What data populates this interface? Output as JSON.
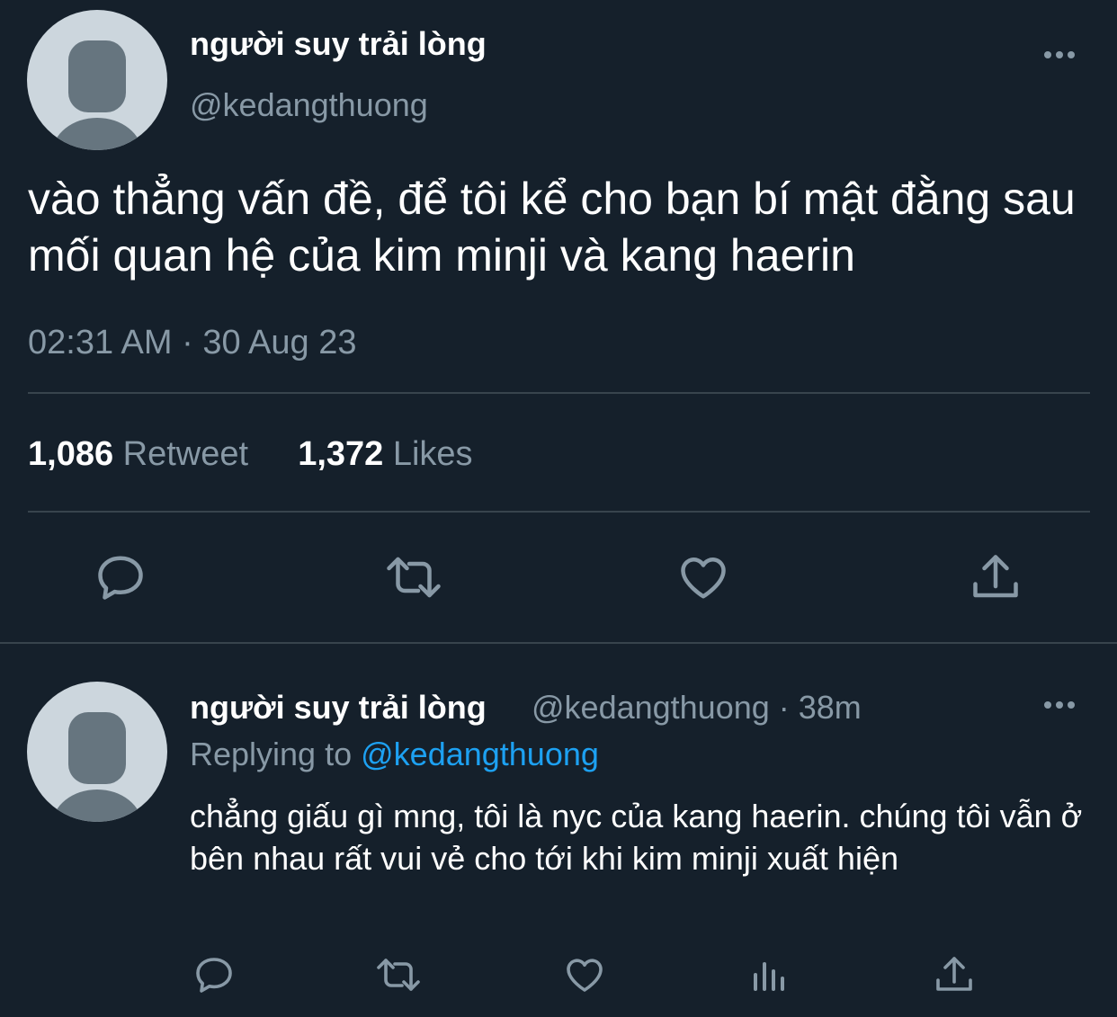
{
  "main_tweet": {
    "author_name": "người suy trải lòng",
    "author_handle": "@kedangthuong",
    "text": "vào thẳng vấn đề, để tôi kể cho bạn bí mật đằng sau mối quan hệ của kim minji và kang haerin",
    "timestamp": "02:31 AM · 30 Aug 23",
    "retweet_count": "1,086",
    "retweet_label": "Retweet",
    "like_count": "1,372",
    "like_label": "Likes",
    "actions": [
      "reply-icon",
      "retweet-icon",
      "heart-icon",
      "share-icon"
    ]
  },
  "reply_tweet": {
    "author_name": "người suy trải lòng",
    "author_handle_time": "@kedangthuong · 38m",
    "replying_prefix": "Replying to",
    "replying_handle": "@kedangthuong",
    "text": "chẳng giấu gì mng, tôi là nyc của kang haerin. chúng tôi vẫn ở bên nhau rất vui vẻ cho tới khi kim minji xuất hiện",
    "actions": [
      "reply-icon",
      "retweet-icon",
      "heart-icon",
      "analytics-icon",
      "share-icon"
    ]
  },
  "colors": {
    "background": "#15202b",
    "secondary_text": "#8899a6",
    "link": "#1da1f2",
    "divider": "#38444d"
  }
}
